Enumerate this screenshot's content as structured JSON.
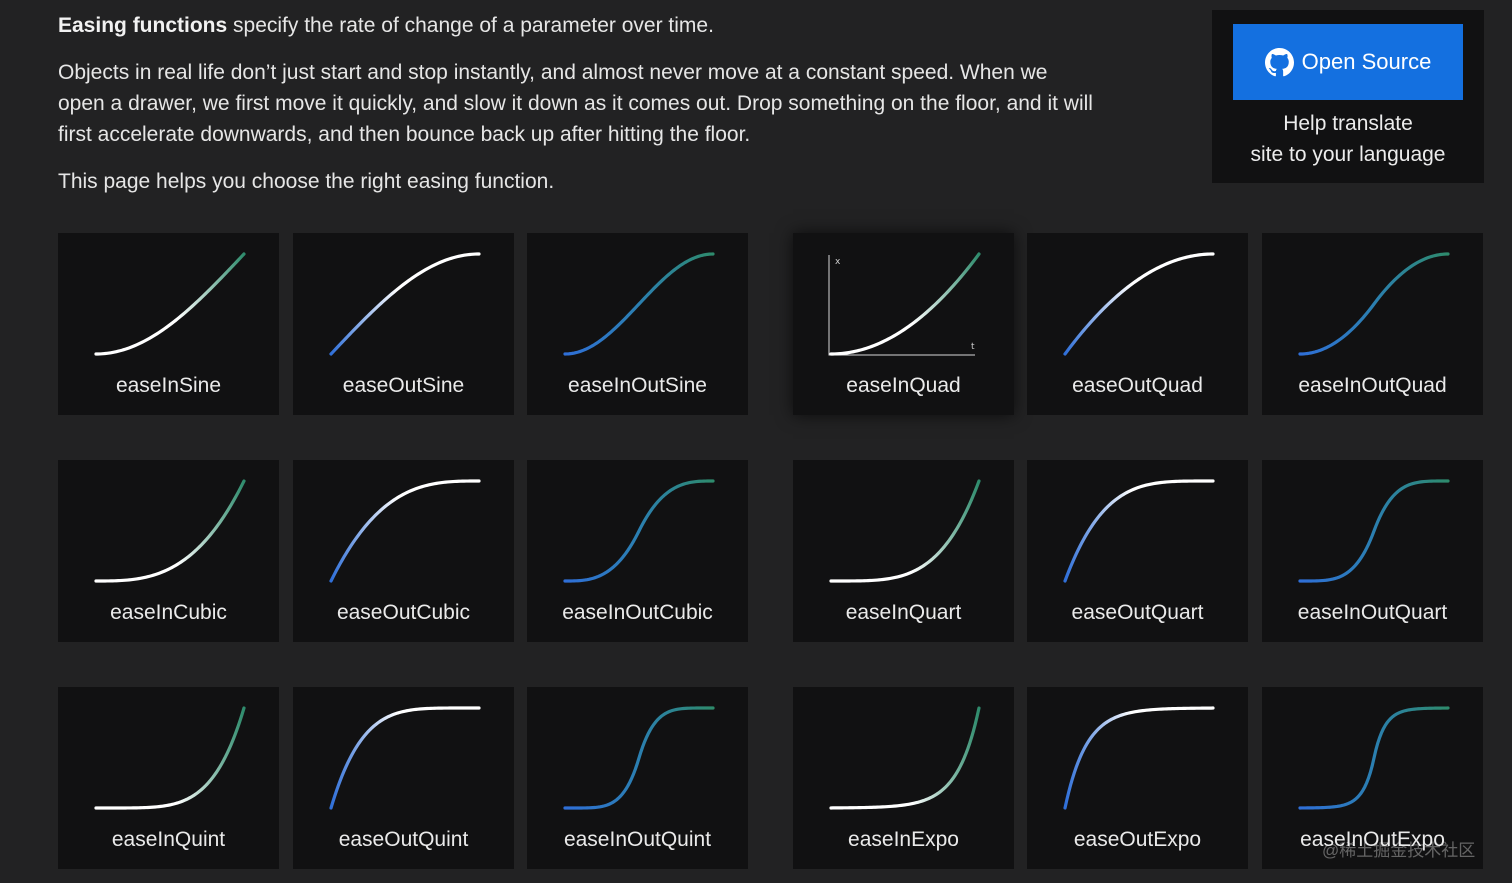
{
  "intro": {
    "title_bold": "Easing functions",
    "title_rest": " specify the rate of change of a parameter over time.",
    "paragraph_1": "Objects in real life don’t just start and stop instantly, and almost never move at a constant speed. When we open a drawer, we first move it quickly, and slow it down as it comes out. Drop something on the floor, and it will first accelerate downwards, and then bounce back up after hitting the floor.",
    "paragraph_2": "This page helps you choose the right easing function."
  },
  "promo": {
    "button_label": "Open Source",
    "icon": "github-icon",
    "line_1": "Help translate",
    "line_2": "site to your language"
  },
  "active_card": "easeInQuad",
  "axis_labels": {
    "x": "x",
    "t": "t"
  },
  "colors": {
    "background": "#222223",
    "card": "#111112",
    "button": "#1470e0",
    "curve_white": "#ffffff",
    "curve_green": "#2e8b6c",
    "curve_blue": "#2f6fd8"
  },
  "cards": [
    {
      "name": "easeInSine",
      "label": "easeInSine"
    },
    {
      "name": "easeOutSine",
      "label": "easeOutSine"
    },
    {
      "name": "easeInOutSine",
      "label": "easeInOutSine"
    },
    {
      "name": "easeInQuad",
      "label": "easeInQuad"
    },
    {
      "name": "easeOutQuad",
      "label": "easeOutQuad"
    },
    {
      "name": "easeInOutQuad",
      "label": "easeInOutQuad"
    },
    {
      "name": "easeInCubic",
      "label": "easeInCubic"
    },
    {
      "name": "easeOutCubic",
      "label": "easeOutCubic"
    },
    {
      "name": "easeInOutCubic",
      "label": "easeInOutCubic"
    },
    {
      "name": "easeInQuart",
      "label": "easeInQuart"
    },
    {
      "name": "easeOutQuart",
      "label": "easeOutQuart"
    },
    {
      "name": "easeInOutQuart",
      "label": "easeInOutQuart"
    },
    {
      "name": "easeInQuint",
      "label": "easeInQuint"
    },
    {
      "name": "easeOutQuint",
      "label": "easeOutQuint"
    },
    {
      "name": "easeInOutQuint",
      "label": "easeInOutQuint"
    },
    {
      "name": "easeInExpo",
      "label": "easeInExpo"
    },
    {
      "name": "easeOutExpo",
      "label": "easeOutExpo"
    },
    {
      "name": "easeInOutExpo",
      "label": "easeInOutExpo"
    }
  ],
  "watermark": "@稀土掘金技术社区"
}
